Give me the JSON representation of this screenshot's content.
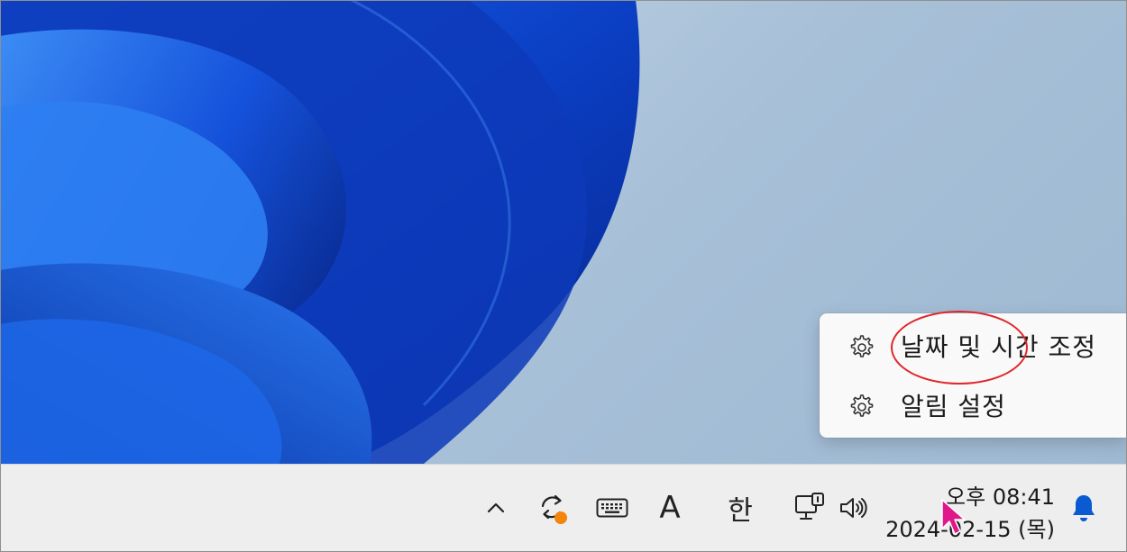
{
  "context_menu": {
    "items": [
      {
        "label": "날짜 및 시간 조정",
        "icon": "gear-icon"
      },
      {
        "label": "알림 설정",
        "icon": "gear-icon"
      }
    ]
  },
  "taskbar": {
    "tray": {
      "ime_label": "한",
      "font_label": "A"
    },
    "clock": {
      "time": "오후 08:41",
      "date": "2024-02-15 (목)"
    }
  },
  "colors": {
    "accent_blue": "#0a5bd1",
    "annotation_red": "#e0262a",
    "cursor_magenta": "#e0178a",
    "sync_badge_orange": "#f5840c"
  }
}
